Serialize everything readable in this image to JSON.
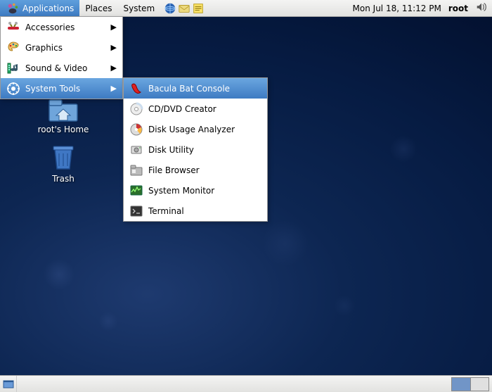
{
  "panel": {
    "applications": "Applications",
    "places": "Places",
    "system": "System",
    "clock": "Mon Jul 18, 11:12 PM",
    "user": "root"
  },
  "apps_menu": {
    "items": [
      {
        "label": "Accessories"
      },
      {
        "label": "Graphics"
      },
      {
        "label": "Sound & Video"
      },
      {
        "label": "System Tools"
      }
    ]
  },
  "system_tools_submenu": {
    "items": [
      {
        "label": "Bacula Bat Console"
      },
      {
        "label": "CD/DVD Creator"
      },
      {
        "label": "Disk Usage Analyzer"
      },
      {
        "label": "Disk Utility"
      },
      {
        "label": "File Browser"
      },
      {
        "label": "System Monitor"
      },
      {
        "label": "Terminal"
      }
    ]
  },
  "desktop": {
    "home_label": "root's Home",
    "trash_label": "Trash"
  },
  "workspaces": {
    "count": 2,
    "active": 0
  }
}
